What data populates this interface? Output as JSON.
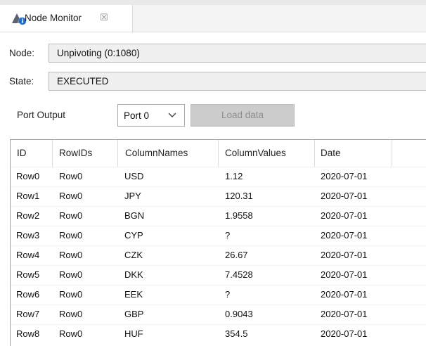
{
  "tab": {
    "title": "Node Monitor",
    "close_symbol": "☒"
  },
  "node": {
    "label": "Node:",
    "value": "Unpivoting  (0:1080)"
  },
  "state": {
    "label": "State:",
    "value": "EXECUTED"
  },
  "port": {
    "label": "Port Output",
    "selected": "Port 0",
    "load_button": "Load data"
  },
  "table": {
    "columns": [
      "ID",
      "RowIDs",
      "ColumnNames",
      "ColumnValues",
      "Date"
    ],
    "rows": [
      [
        "Row0",
        "Row0",
        "USD",
        "1.12",
        "2020-07-01"
      ],
      [
        "Row1",
        "Row0",
        "JPY",
        "120.31",
        "2020-07-01"
      ],
      [
        "Row2",
        "Row0",
        "BGN",
        "1.9558",
        "2020-07-01"
      ],
      [
        "Row3",
        "Row0",
        "CYP",
        "?",
        "2020-07-01"
      ],
      [
        "Row4",
        "Row0",
        "CZK",
        "26.67",
        "2020-07-01"
      ],
      [
        "Row5",
        "Row0",
        "DKK",
        "7.4528",
        "2020-07-01"
      ],
      [
        "Row6",
        "Row0",
        "EEK",
        "?",
        "2020-07-01"
      ],
      [
        "Row7",
        "Row0",
        "GBP",
        "0.9043",
        "2020-07-01"
      ],
      [
        "Row8",
        "Row0",
        "HUF",
        "354.5",
        "2020-07-01"
      ]
    ]
  }
}
